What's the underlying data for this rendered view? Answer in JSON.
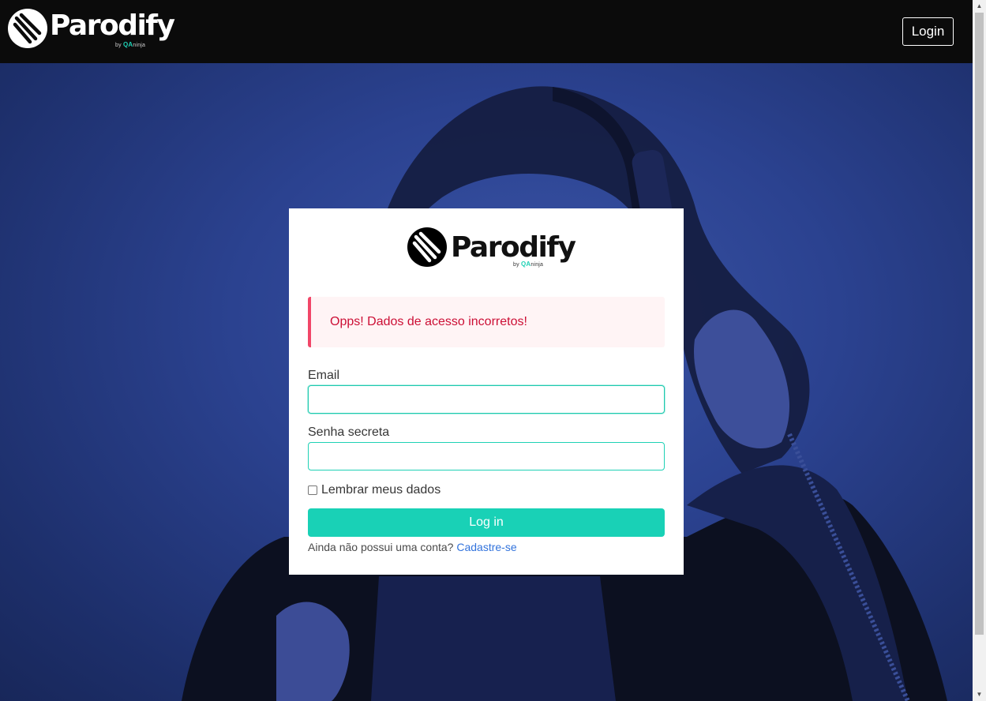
{
  "navbar": {
    "brand": "Parodify",
    "brand_by": "by",
    "brand_qa": "QA",
    "brand_ninja": "ninja",
    "login_button": "Login"
  },
  "card": {
    "brand": "Parodify",
    "brand_by": "by",
    "brand_qa": "QA",
    "brand_ninja": "ninja",
    "alert": "Opps! Dados de acesso incorretos!",
    "email_label": "Email",
    "email_value": "",
    "password_label": "Senha secreta",
    "password_value": "",
    "remember_label": "Lembrar meus dados",
    "remember_checked": false,
    "submit_label": "Log in",
    "signup_prompt": "Ainda não possui uma conta?",
    "signup_link": "Cadastre-se"
  },
  "colors": {
    "navbar_bg": "#0b0b0b",
    "accent": "#19d1b6",
    "alert_text": "#cc0f35",
    "alert_border": "#f14668",
    "link": "#3273dc"
  },
  "icons": {
    "brand_logo": "parodify-logo-icon"
  }
}
